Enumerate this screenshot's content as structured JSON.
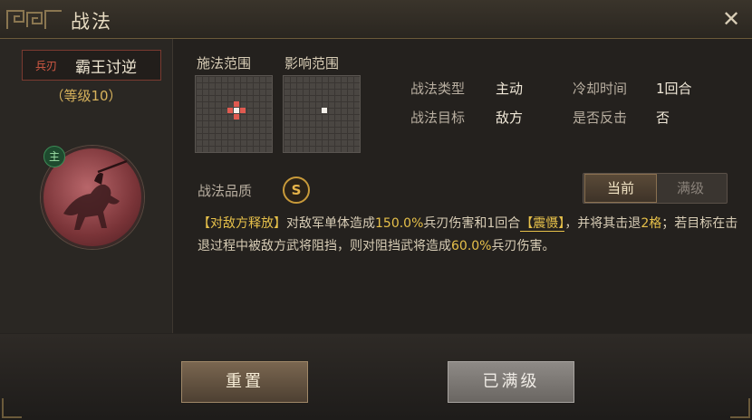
{
  "window": {
    "title": "战法",
    "close": "✕"
  },
  "skill": {
    "tag": "兵刃",
    "name": "霸王讨逆",
    "level": "（等级10）",
    "badge": "主"
  },
  "range": {
    "cast_label": "施法范围",
    "effect_label": "影响范围"
  },
  "info": {
    "type_label": "战法类型",
    "type_value": "主动",
    "cooldown_label": "冷却时间",
    "cooldown_value": "1回合",
    "target_label": "战法目标",
    "target_value": "敌方",
    "counter_label": "是否反击",
    "counter_value": "否"
  },
  "quality": {
    "label": "战法品质",
    "value": "S"
  },
  "toggle": {
    "current": "当前",
    "max": "满级"
  },
  "description": {
    "p1": "【对敌方释放】",
    "p2": "对敌军单体造成",
    "p3": "150.0%",
    "p4": "兵刃伤害和1回合",
    "p5": "【震慑】",
    "p6": "，并将其击退",
    "p7": "2格",
    "p8": "；若目标在击退过程中被敌方武将阻挡，则对阻挡武将造成",
    "p9": "60.0%",
    "p10": "兵刃伤害。"
  },
  "buttons": {
    "reset": "重置",
    "maxed": "已满级"
  },
  "colors": {
    "accent_gold": "#e6c04a",
    "tag_red": "#d65a45",
    "cast_cell": "#e05a50"
  }
}
